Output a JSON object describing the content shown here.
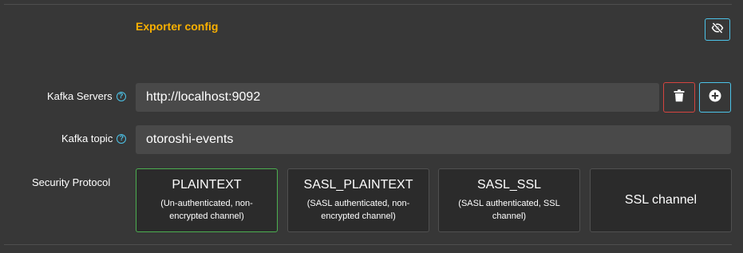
{
  "section": {
    "title": "Exporter config",
    "hide_icon": "eye-slash-icon"
  },
  "kafka_servers": {
    "label": "Kafka Servers",
    "help_glyph": "?",
    "value": "http://localhost:9092",
    "delete_icon": "trash-icon",
    "add_icon": "plus-circle-icon"
  },
  "kafka_topic": {
    "label": "Kafka topic",
    "help_glyph": "?",
    "value": "otoroshi-events"
  },
  "security_protocol": {
    "label": "Security Protocol",
    "selected": "PLAINTEXT",
    "options": [
      {
        "name": "PLAINTEXT",
        "description": "(Un-authenticated, non-encrypted channel)"
      },
      {
        "name": "SASL_PLAINTEXT",
        "description": "(SASL authenticated, non-encrypted channel)"
      },
      {
        "name": "SASL_SSL",
        "description": "(SASL authenticated, SSL channel)"
      },
      {
        "name": "SSL channel",
        "description": ""
      }
    ]
  },
  "colors": {
    "accent_orange": "#f9b000",
    "info_blue": "#4cc3e8",
    "danger_red": "#d5443f",
    "selected_green": "#4caf50",
    "background": "#373737",
    "input_bg": "#494949",
    "card_bg": "#2b2b2b"
  }
}
